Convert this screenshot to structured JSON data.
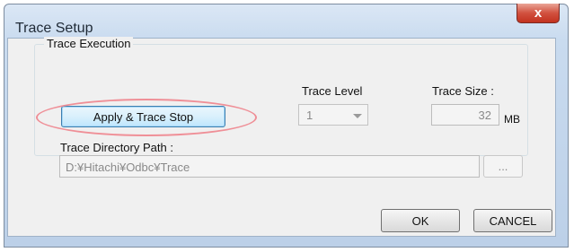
{
  "window": {
    "title": "Trace Setup",
    "close_glyph": "x"
  },
  "group": {
    "label": "Trace Execution"
  },
  "apply_button": {
    "label": "Apply & Trace Stop"
  },
  "trace_level": {
    "label": "Trace Level",
    "value": "1"
  },
  "trace_size": {
    "label": "Trace Size :",
    "value": "32",
    "unit": "MB"
  },
  "directory": {
    "label": "Trace Directory Path :",
    "value": "D:¥Hitachi¥Odbc¥Trace",
    "browse_label": "..."
  },
  "buttons": {
    "ok": "OK",
    "cancel": "CANCEL"
  },
  "colors": {
    "highlight": "#ef8f97",
    "close": "#c2321f"
  }
}
